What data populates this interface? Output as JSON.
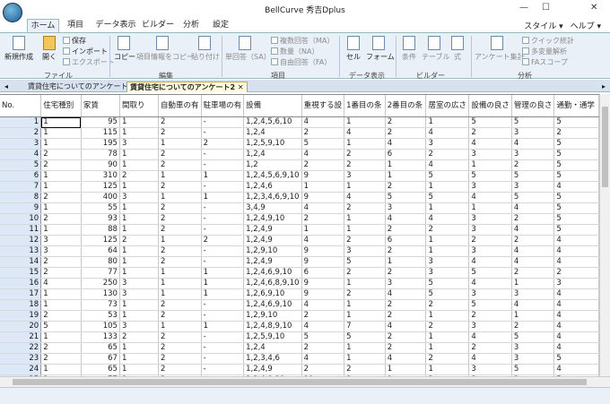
{
  "app": {
    "title": "BellCurve 秀吉Dplus"
  },
  "menu": {
    "tabs": [
      "ホーム",
      "項目",
      "データ表示",
      "ビルダー",
      "分析",
      "設定"
    ],
    "style": "スタイル",
    "style_arrow": "▾",
    "help": "ヘルプ",
    "help_arrow": "▾"
  },
  "ribbon": {
    "new": "新規作成",
    "open": "開く",
    "save": "保存",
    "import": "インポート",
    "export": "エクスポート",
    "copy": "コピー",
    "copy_item": "項目情報をコピー",
    "paste": "貼り付け",
    "single": "単回答（SA）",
    "multi": "複数回答（MA）",
    "num": "数量（NA）",
    "free": "自由回答（FA）",
    "cell": "セル",
    "form": "フォーム",
    "cond": "条件",
    "table": "テーブル",
    "formula": "式",
    "survey": "アンケート集計",
    "quick": "クイック統計",
    "multivar": "多変量解析",
    "fa": "FAスコープ",
    "groups": {
      "file": "ファイル",
      "edit": "編集",
      "item": "項目",
      "display": "データ表示",
      "builder": "ビルダー",
      "analysis": "分析"
    }
  },
  "doc_tabs": [
    "賃貸住宅についてのアンケート1",
    "賃貸住宅についてのアンケート2"
  ],
  "grid": {
    "columns": [
      "No.",
      "住宅種別",
      "家賃",
      "間取り",
      "自動車の有",
      "駐車場の有",
      "設備",
      "重視する設",
      "1番目の条",
      "2番目の条",
      "居室の広さ",
      "設備の良さ",
      "管理の良さ",
      "通勤・通学"
    ],
    "rows": [
      [
        "1",
        "1",
        "95",
        "1",
        "2",
        "-",
        "1,2,4,5,6,10",
        "4",
        "1",
        "2",
        "1",
        "5",
        "5",
        "5"
      ],
      [
        "2",
        "1",
        "115",
        "1",
        "2",
        "-",
        "1,2,4",
        "2",
        "4",
        "2",
        "4",
        "2",
        "3",
        "2"
      ],
      [
        "3",
        "1",
        "195",
        "3",
        "1",
        "2",
        "1,2,5,9,10",
        "5",
        "1",
        "4",
        "3",
        "4",
        "4",
        "5"
      ],
      [
        "4",
        "2",
        "78",
        "1",
        "2",
        "-",
        "1,2,4",
        "4",
        "2",
        "6",
        "2",
        "3",
        "3",
        "5"
      ],
      [
        "5",
        "2",
        "90",
        "1",
        "2",
        "-",
        "1,2",
        "2",
        "2",
        "1",
        "4",
        "1",
        "2",
        "5"
      ],
      [
        "6",
        "1",
        "310",
        "2",
        "1",
        "1",
        "1,2,4,5,6,9,10",
        "9",
        "3",
        "1",
        "5",
        "5",
        "5",
        "5"
      ],
      [
        "7",
        "1",
        "125",
        "1",
        "2",
        "-",
        "1,2,4,6",
        "1",
        "1",
        "2",
        "1",
        "3",
        "3",
        "4"
      ],
      [
        "8",
        "2",
        "400",
        "3",
        "1",
        "1",
        "1,2,3,4,6,9,10",
        "9",
        "4",
        "5",
        "5",
        "4",
        "5",
        "5"
      ],
      [
        "9",
        "1",
        "55",
        "1",
        "2",
        "-",
        "3,4,9",
        "4",
        "2",
        "3",
        "1",
        "1",
        "4",
        "5"
      ],
      [
        "10",
        "2",
        "93",
        "1",
        "2",
        "-",
        "1,2,4,9,10",
        "2",
        "1",
        "4",
        "4",
        "3",
        "2",
        "5"
      ],
      [
        "11",
        "1",
        "88",
        "1",
        "2",
        "-",
        "1,2,4,9",
        "1",
        "1",
        "2",
        "2",
        "3",
        "4",
        "5"
      ],
      [
        "12",
        "3",
        "125",
        "2",
        "1",
        "2",
        "1,2,4,9",
        "4",
        "2",
        "6",
        "1",
        "2",
        "2",
        "4"
      ],
      [
        "13",
        "3",
        "64",
        "1",
        "2",
        "-",
        "1,2,9,10",
        "9",
        "3",
        "2",
        "1",
        "3",
        "4",
        "4"
      ],
      [
        "14",
        "2",
        "80",
        "1",
        "2",
        "-",
        "1,2,4,9",
        "9",
        "5",
        "1",
        "3",
        "4",
        "4",
        "4"
      ],
      [
        "15",
        "2",
        "77",
        "1",
        "1",
        "1",
        "1,2,4,6,9,10",
        "6",
        "2",
        "2",
        "3",
        "5",
        "2",
        "2"
      ],
      [
        "16",
        "4",
        "250",
        "3",
        "1",
        "1",
        "1,2,4,6,8,9,10",
        "9",
        "1",
        "3",
        "5",
        "4",
        "1",
        "3"
      ],
      [
        "17",
        "1",
        "130",
        "3",
        "1",
        "1",
        "1,2,6,9,10",
        "9",
        "2",
        "4",
        "5",
        "3",
        "3",
        "4"
      ],
      [
        "18",
        "1",
        "73",
        "1",
        "2",
        "-",
        "1,2,4,6,9,10",
        "4",
        "1",
        "2",
        "2",
        "5",
        "4",
        "4"
      ],
      [
        "19",
        "2",
        "53",
        "1",
        "2",
        "-",
        "1,2,9,10",
        "2",
        "1",
        "2",
        "1",
        "2",
        "1",
        "4"
      ],
      [
        "20",
        "5",
        "105",
        "3",
        "1",
        "1",
        "1,2,4,8,9,10",
        "4",
        "7",
        "4",
        "2",
        "3",
        "2",
        "4"
      ],
      [
        "21",
        "1",
        "133",
        "2",
        "2",
        "-",
        "1,2,5,9,10",
        "5",
        "5",
        "2",
        "1",
        "4",
        "5",
        "4"
      ],
      [
        "22",
        "2",
        "65",
        "1",
        "2",
        "-",
        "1,2,4",
        "2",
        "1",
        "2",
        "1",
        "2",
        "3",
        "4"
      ],
      [
        "23",
        "2",
        "67",
        "1",
        "2",
        "-",
        "1,2,3,4,6",
        "4",
        "1",
        "4",
        "2",
        "4",
        "3",
        "5"
      ],
      [
        "24",
        "1",
        "65",
        "1",
        "2",
        "-",
        "1,2,4,9",
        "2",
        "2",
        "1",
        "1",
        "3",
        "5",
        "4"
      ],
      [
        "25",
        "2",
        "77",
        "1",
        "2",
        "-",
        "1,2,4,9,10",
        "10",
        "2",
        "1",
        "2",
        "3",
        "2",
        "5"
      ]
    ]
  }
}
